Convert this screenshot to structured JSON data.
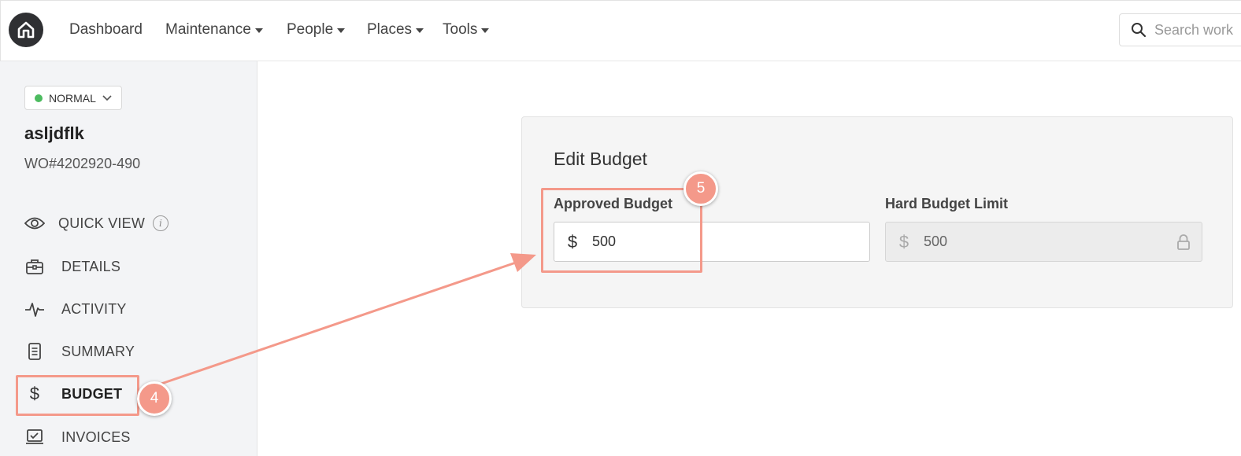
{
  "nav": {
    "items": [
      {
        "label": "Dashboard",
        "dropdown": false
      },
      {
        "label": "Maintenance",
        "dropdown": true
      },
      {
        "label": "People",
        "dropdown": true
      },
      {
        "label": "Places",
        "dropdown": true
      },
      {
        "label": "Tools",
        "dropdown": true
      }
    ],
    "search_placeholder": "Search work"
  },
  "sidebar": {
    "status_label": "NORMAL",
    "status_color": "#4cbb5f",
    "wo_name": "asljdflk",
    "wo_number": "WO#4202920-490",
    "items": [
      {
        "label": "QUICK VIEW",
        "icon": "eye-icon"
      },
      {
        "label": "DETAILS",
        "icon": "briefcase-icon"
      },
      {
        "label": "ACTIVITY",
        "icon": "pulse-icon"
      },
      {
        "label": "SUMMARY",
        "icon": "document-icon"
      },
      {
        "label": "BUDGET",
        "icon": "dollar-icon",
        "active": true
      },
      {
        "label": "INVOICES",
        "icon": "invoice-icon"
      }
    ]
  },
  "budget": {
    "title": "Edit Budget",
    "approved_label": "Approved Budget",
    "approved_value": "500",
    "hard_limit_label": "Hard Budget Limit",
    "hard_limit_value": "500",
    "currency_symbol": "$"
  },
  "annotations": {
    "step_a": "4",
    "step_b": "5",
    "accent_color": "#f4998a"
  }
}
